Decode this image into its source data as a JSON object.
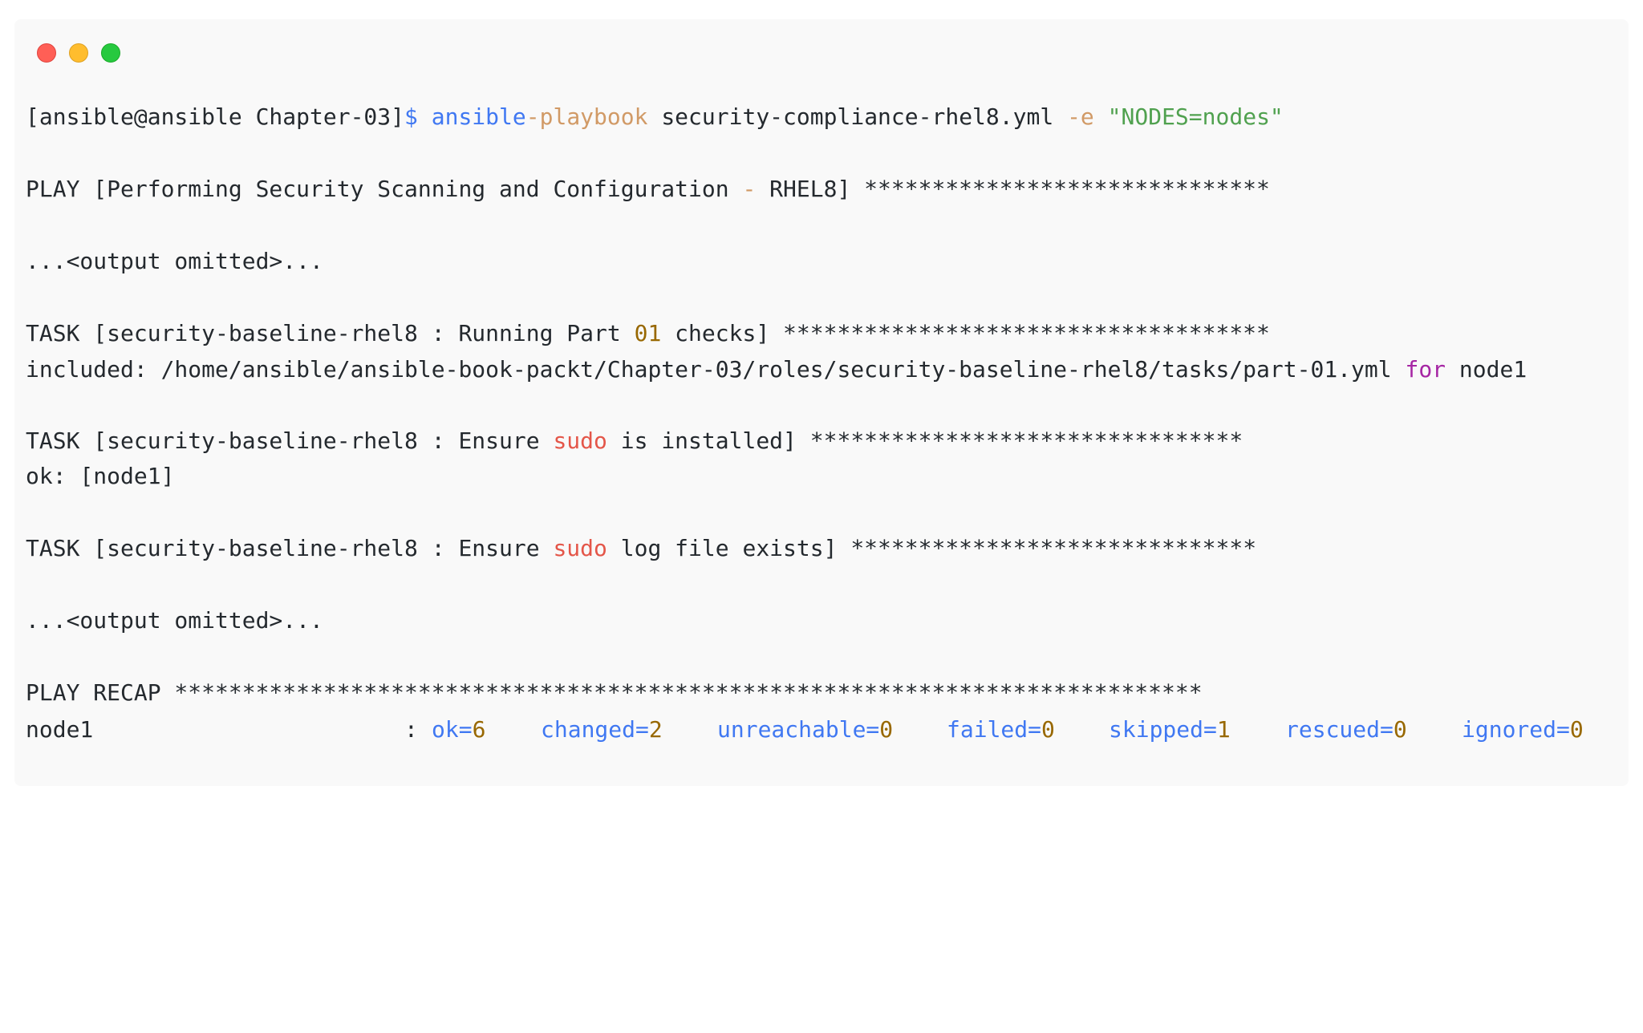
{
  "window": {
    "buttons": [
      "close",
      "minimize",
      "maximize"
    ]
  },
  "terminal": {
    "command": {
      "prompt": "[ansible@ansible Chapter-03]",
      "dollar": "$",
      "cmd_part1": "ansible",
      "cmd_part2": "-playbook",
      "arg_file": " security-compliance-rhel8.yml ",
      "flag": "-e",
      "space": " ",
      "extra_var": "\"NODES=nodes\""
    },
    "play": {
      "prefix": "PLAY [Performing Security Scanning and Configuration ",
      "dash": "-",
      "suffix": " RHEL8] ******************************"
    },
    "omitted1": "...<output omitted>...",
    "task1": {
      "prefix": "TASK [security-baseline-rhel8 : Running Part ",
      "num": "01",
      "suffix": " checks] ************************************"
    },
    "included": {
      "prefix": "included: /home/ansible/ansible-book-packt/Chapter-03/roles/security-baseline-rhel8/tasks/part-01.yml ",
      "keyword": "for",
      "suffix": " node1"
    },
    "task2": {
      "prefix": "TASK [security-baseline-rhel8 : Ensure ",
      "keyword": "sudo",
      "suffix": " is installed] ********************************"
    },
    "ok_line": "ok: [node1]",
    "task3": {
      "prefix": "TASK [security-baseline-rhel8 : Ensure ",
      "keyword": "sudo",
      "suffix": " log file exists] ******************************"
    },
    "omitted2": "...<output omitted>...",
    "recap_header": "PLAY RECAP ****************************************************************************",
    "recap": {
      "host": "node1",
      "colon": ":",
      "stats": [
        {
          "label": "ok=",
          "value": "6"
        },
        {
          "label": "changed=",
          "value": "2"
        },
        {
          "label": "unreachable=",
          "value": "0"
        },
        {
          "label": "failed=",
          "value": "0"
        },
        {
          "label": "skipped=",
          "value": "1"
        },
        {
          "label": "rescued=",
          "value": "0"
        },
        {
          "label": "ignored=",
          "value": "0"
        }
      ]
    }
  },
  "colors": {
    "background": "#f9f9f9",
    "text": "#24292e",
    "blue": "#4078f2",
    "orange": "#d19a66",
    "green": "#50a14f",
    "number": "#986801",
    "red": "#e45649",
    "purple": "#a626a4"
  }
}
